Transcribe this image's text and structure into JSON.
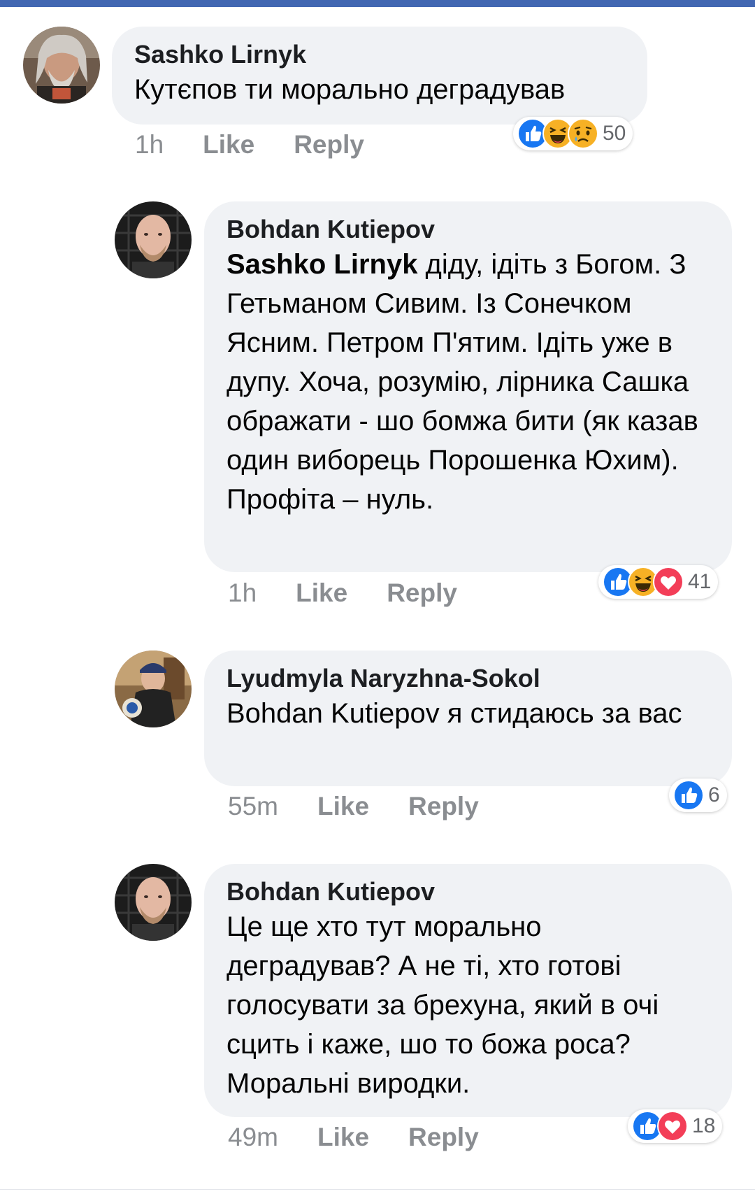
{
  "comments": [
    {
      "author": "Sashko Lirnyk",
      "text": "Кутєпов ти морально деградував",
      "time": "1h",
      "like_label": "Like",
      "reply_label": "Reply",
      "reactions": [
        "like",
        "haha",
        "sad"
      ],
      "reaction_count": "50"
    },
    {
      "author": "Bohdan Kutiepov",
      "mention": "Sashko Lirnyk",
      "text": " діду, ідіть з Богом. З Гетьманом Сивим. Із Сонечком Ясним. Петром П'ятим. Ідіть уже в дупу. Хоча, розумію, лірника Сашка ображати - шо бомжа бити (як казав один виборець Порошенка Юхим). Профіта – нуль.",
      "time": "1h",
      "like_label": "Like",
      "reply_label": "Reply",
      "reactions": [
        "like",
        "haha",
        "love"
      ],
      "reaction_count": "41"
    },
    {
      "author": "Lyudmyla Naryzhna-Sokol",
      "text": "Bohdan Kutiepov я стидаюсь за вас",
      "time": "55m",
      "like_label": "Like",
      "reply_label": "Reply",
      "reactions": [
        "like"
      ],
      "reaction_count": "6"
    },
    {
      "author": "Bohdan Kutiepov",
      "text": "Це ще хто тут морально деградував? А не ті, хто готові голосувати за брехуна, який в очі сцить і каже, шо то божа роса? Моральні виродки.",
      "time": "49m",
      "like_label": "Like",
      "reply_label": "Reply",
      "reactions": [
        "like",
        "love"
      ],
      "reaction_count": "18"
    }
  ],
  "colors": {
    "like": "#1877f2",
    "love": "#f33e58",
    "haha": "#f7b125",
    "bubble": "#f0f2f5",
    "meta": "#8a8d91",
    "topbar": "#4267b2"
  }
}
